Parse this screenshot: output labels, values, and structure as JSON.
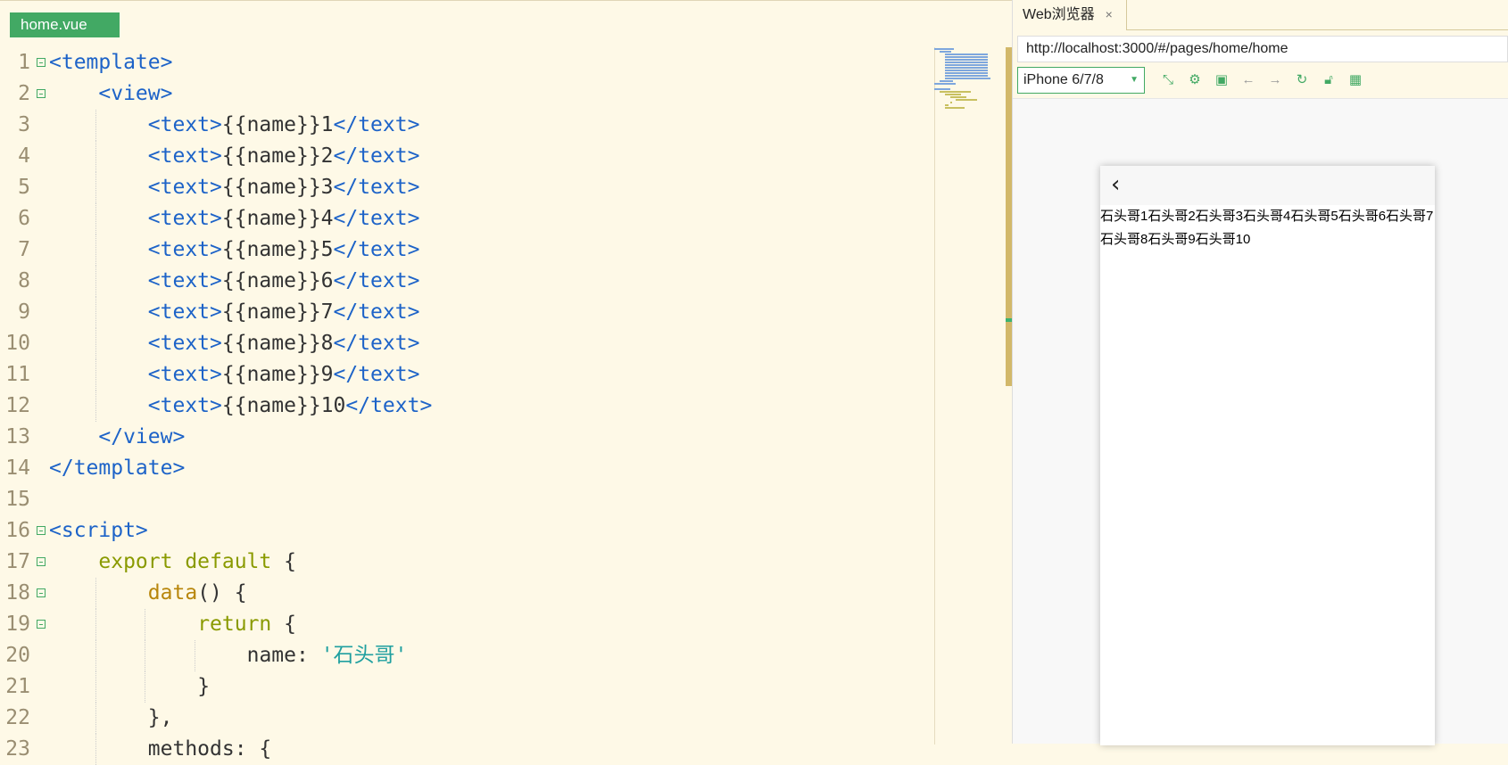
{
  "editor": {
    "file_tab": "home.vue",
    "lines": [
      {
        "n": "1",
        "fold": true,
        "indent": 0,
        "tokens": [
          [
            "tag",
            "<template>"
          ]
        ]
      },
      {
        "n": "2",
        "fold": true,
        "indent": 1,
        "tokens": [
          [
            "tag",
            "<view>"
          ]
        ]
      },
      {
        "n": "3",
        "indent": 2,
        "tokens": [
          [
            "tag",
            "<text>"
          ],
          [
            "plain",
            "{{name}}1"
          ],
          [
            "tag",
            "</text>"
          ]
        ]
      },
      {
        "n": "4",
        "indent": 2,
        "tokens": [
          [
            "tag",
            "<text>"
          ],
          [
            "plain",
            "{{name}}2"
          ],
          [
            "tag",
            "</text>"
          ]
        ]
      },
      {
        "n": "5",
        "indent": 2,
        "tokens": [
          [
            "tag",
            "<text>"
          ],
          [
            "plain",
            "{{name}}3"
          ],
          [
            "tag",
            "</text>"
          ]
        ]
      },
      {
        "n": "6",
        "indent": 2,
        "tokens": [
          [
            "tag",
            "<text>"
          ],
          [
            "plain",
            "{{name}}4"
          ],
          [
            "tag",
            "</text>"
          ]
        ]
      },
      {
        "n": "7",
        "indent": 2,
        "tokens": [
          [
            "tag",
            "<text>"
          ],
          [
            "plain",
            "{{name}}5"
          ],
          [
            "tag",
            "</text>"
          ]
        ]
      },
      {
        "n": "8",
        "indent": 2,
        "tokens": [
          [
            "tag",
            "<text>"
          ],
          [
            "plain",
            "{{name}}6"
          ],
          [
            "tag",
            "</text>"
          ]
        ]
      },
      {
        "n": "9",
        "indent": 2,
        "tokens": [
          [
            "tag",
            "<text>"
          ],
          [
            "plain",
            "{{name}}7"
          ],
          [
            "tag",
            "</text>"
          ]
        ]
      },
      {
        "n": "10",
        "indent": 2,
        "tokens": [
          [
            "tag",
            "<text>"
          ],
          [
            "plain",
            "{{name}}8"
          ],
          [
            "tag",
            "</text>"
          ]
        ]
      },
      {
        "n": "11",
        "indent": 2,
        "tokens": [
          [
            "tag",
            "<text>"
          ],
          [
            "plain",
            "{{name}}9"
          ],
          [
            "tag",
            "</text>"
          ]
        ]
      },
      {
        "n": "12",
        "indent": 2,
        "tokens": [
          [
            "tag",
            "<text>"
          ],
          [
            "plain",
            "{{name}}10"
          ],
          [
            "tag",
            "</text>"
          ]
        ]
      },
      {
        "n": "13",
        "indent": 1,
        "tokens": [
          [
            "tag",
            "</view>"
          ]
        ]
      },
      {
        "n": "14",
        "indent": 0,
        "tokens": [
          [
            "tag",
            "</template>"
          ]
        ]
      },
      {
        "n": "15",
        "indent": 0,
        "tokens": []
      },
      {
        "n": "16",
        "fold": true,
        "indent": 0,
        "tokens": [
          [
            "tag",
            "<script>"
          ]
        ]
      },
      {
        "n": "17",
        "fold": true,
        "indent": 1,
        "tokens": [
          [
            "kw",
            "export default"
          ],
          [
            "plain",
            " {"
          ]
        ]
      },
      {
        "n": "18",
        "fold": true,
        "indent": 2,
        "tokens": [
          [
            "fn",
            "data"
          ],
          [
            "plain",
            "() {"
          ]
        ]
      },
      {
        "n": "19",
        "fold": true,
        "indent": 3,
        "tokens": [
          [
            "kw",
            "return"
          ],
          [
            "plain",
            " {"
          ]
        ]
      },
      {
        "n": "20",
        "indent": 4,
        "tokens": [
          [
            "plain",
            "name: "
          ],
          [
            "str",
            "'石头哥'"
          ]
        ]
      },
      {
        "n": "21",
        "indent": 3,
        "tokens": [
          [
            "plain",
            "}"
          ]
        ]
      },
      {
        "n": "22",
        "indent": 2,
        "tokens": [
          [
            "plain",
            "},"
          ]
        ]
      },
      {
        "n": "23",
        "indent": 2,
        "tokens": [
          [
            "plain",
            "methods: {"
          ]
        ]
      }
    ]
  },
  "browser": {
    "tab_label": "Web浏览器",
    "tab_close": "×",
    "url": "http://localhost:3000/#/pages/home/home",
    "device": "iPhone 6/7/8",
    "toolbar_icons": [
      "rotate-icon",
      "settings-icon",
      "console-icon",
      "back-arrow-icon",
      "forward-arrow-icon",
      "refresh-icon",
      "unlock-icon",
      "qrcode-icon"
    ],
    "back_glyph": "‹",
    "page_text": "石头哥1石头哥2石头哥3石头哥4石头哥5石头哥6石头哥7石头哥8石头哥9石头哥10"
  },
  "colors": {
    "accent": "#42a964",
    "tag": "#1d63c8",
    "keyword": "#8a9a00",
    "string": "#20a0a0",
    "editor_bg": "#fef9e7"
  }
}
